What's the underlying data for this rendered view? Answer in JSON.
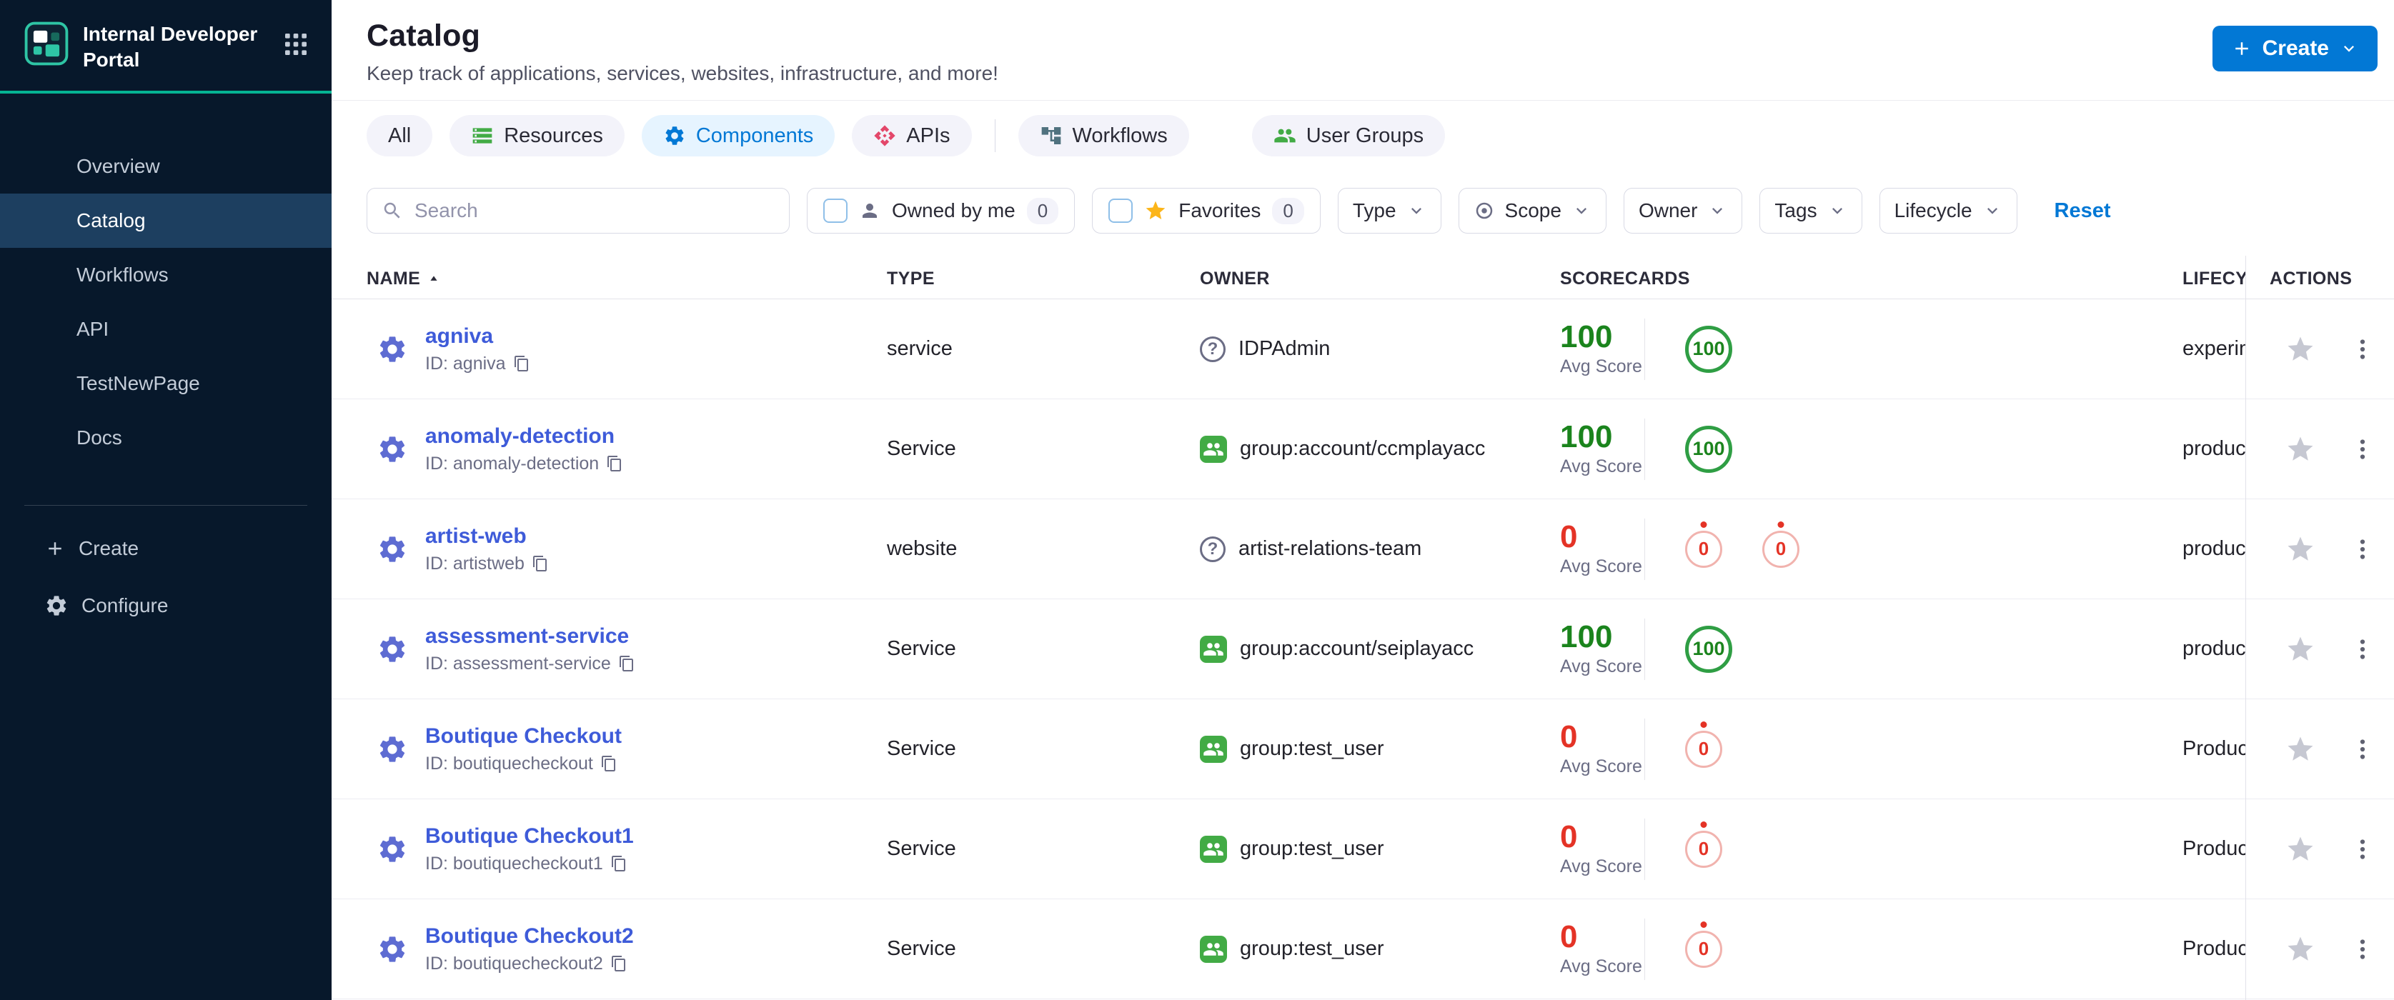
{
  "sidebar": {
    "title": "Internal Developer Portal",
    "items": [
      {
        "label": "Overview"
      },
      {
        "label": "Catalog",
        "active": true
      },
      {
        "label": "Workflows"
      },
      {
        "label": "API"
      },
      {
        "label": "TestNewPage"
      },
      {
        "label": "Docs"
      }
    ],
    "create_label": "Create",
    "configure_label": "Configure"
  },
  "header": {
    "title": "Catalog",
    "subtitle": "Keep track of applications, services, websites, infrastructure, and more!",
    "create_button_label": "Create"
  },
  "tabs": [
    {
      "label": "All",
      "icon": "",
      "active": false
    },
    {
      "label": "Resources",
      "icon": "resources-icon",
      "active": false
    },
    {
      "label": "Components",
      "icon": "components-gear-icon",
      "active": true
    },
    {
      "label": "APIs",
      "icon": "apis-icon",
      "active": false
    },
    {
      "label": "Workflows",
      "icon": "workflows-icon",
      "active": false
    },
    {
      "label": "User Groups",
      "icon": "user-groups-icon",
      "active": false
    }
  ],
  "filters": {
    "search_placeholder": "Search",
    "owned_by_me": {
      "label": "Owned by me",
      "count": "0"
    },
    "favorites": {
      "label": "Favorites",
      "count": "0"
    },
    "dropdowns": [
      {
        "label": "Type"
      },
      {
        "label": "Scope",
        "icon": "scope-icon"
      },
      {
        "label": "Owner"
      },
      {
        "label": "Tags"
      },
      {
        "label": "Lifecycle"
      }
    ],
    "reset_label": "Reset"
  },
  "table": {
    "columns": [
      "NAME",
      "TYPE",
      "OWNER",
      "SCORECARDS",
      "LIFECYCLE",
      "ACTIONS"
    ],
    "avg_score_label": "Avg Score",
    "rows": [
      {
        "name": "agniva",
        "id": "ID: agniva",
        "type": "service",
        "owner": "IDPAdmin",
        "owner_kind": "user",
        "score": "100",
        "badges": [
          "100"
        ],
        "status": "pass",
        "lifecycle": "experimental"
      },
      {
        "name": "anomaly-detection",
        "id": "ID: anomaly-detection",
        "type": "Service",
        "owner": "group:account/ccmplayacc",
        "owner_kind": "group",
        "score": "100",
        "badges": [
          "100"
        ],
        "status": "pass",
        "lifecycle": "production"
      },
      {
        "name": "artist-web",
        "id": "ID: artistweb",
        "type": "website",
        "owner": "artist-relations-team",
        "owner_kind": "user",
        "score": "0",
        "badges": [
          "0",
          "0"
        ],
        "status": "fail",
        "lifecycle": "production"
      },
      {
        "name": "assessment-service",
        "id": "ID: assessment-service",
        "type": "Service",
        "owner": "group:account/seiplayacc",
        "owner_kind": "group",
        "score": "100",
        "badges": [
          "100"
        ],
        "status": "pass",
        "lifecycle": "production"
      },
      {
        "name": "Boutique Checkout",
        "id": "ID: boutiquecheckout",
        "type": "Service",
        "owner": "group:test_user",
        "owner_kind": "group",
        "score": "0",
        "badges": [
          "0"
        ],
        "status": "fail",
        "lifecycle": "Production"
      },
      {
        "name": "Boutique Checkout1",
        "id": "ID: boutiquecheckout1",
        "type": "Service",
        "owner": "group:test_user",
        "owner_kind": "group",
        "score": "0",
        "badges": [
          "0"
        ],
        "status": "fail",
        "lifecycle": "Production"
      },
      {
        "name": "Boutique Checkout2",
        "id": "ID: boutiquecheckout2",
        "type": "Service",
        "owner": "group:test_user",
        "owner_kind": "group",
        "score": "0",
        "badges": [
          "0"
        ],
        "status": "fail",
        "lifecycle": "Production"
      }
    ]
  },
  "colors": {
    "accent_blue": "#0278d5",
    "sidebar_bg": "#07182b",
    "module_accent": "#05b393",
    "score_pass_green": "#1b841d",
    "score_fail_red": "#e43326",
    "group_icon_green": "#42ab45",
    "favorite_star_yellow": "#fcb519",
    "entity_link_blue": "#3e5bd9"
  }
}
